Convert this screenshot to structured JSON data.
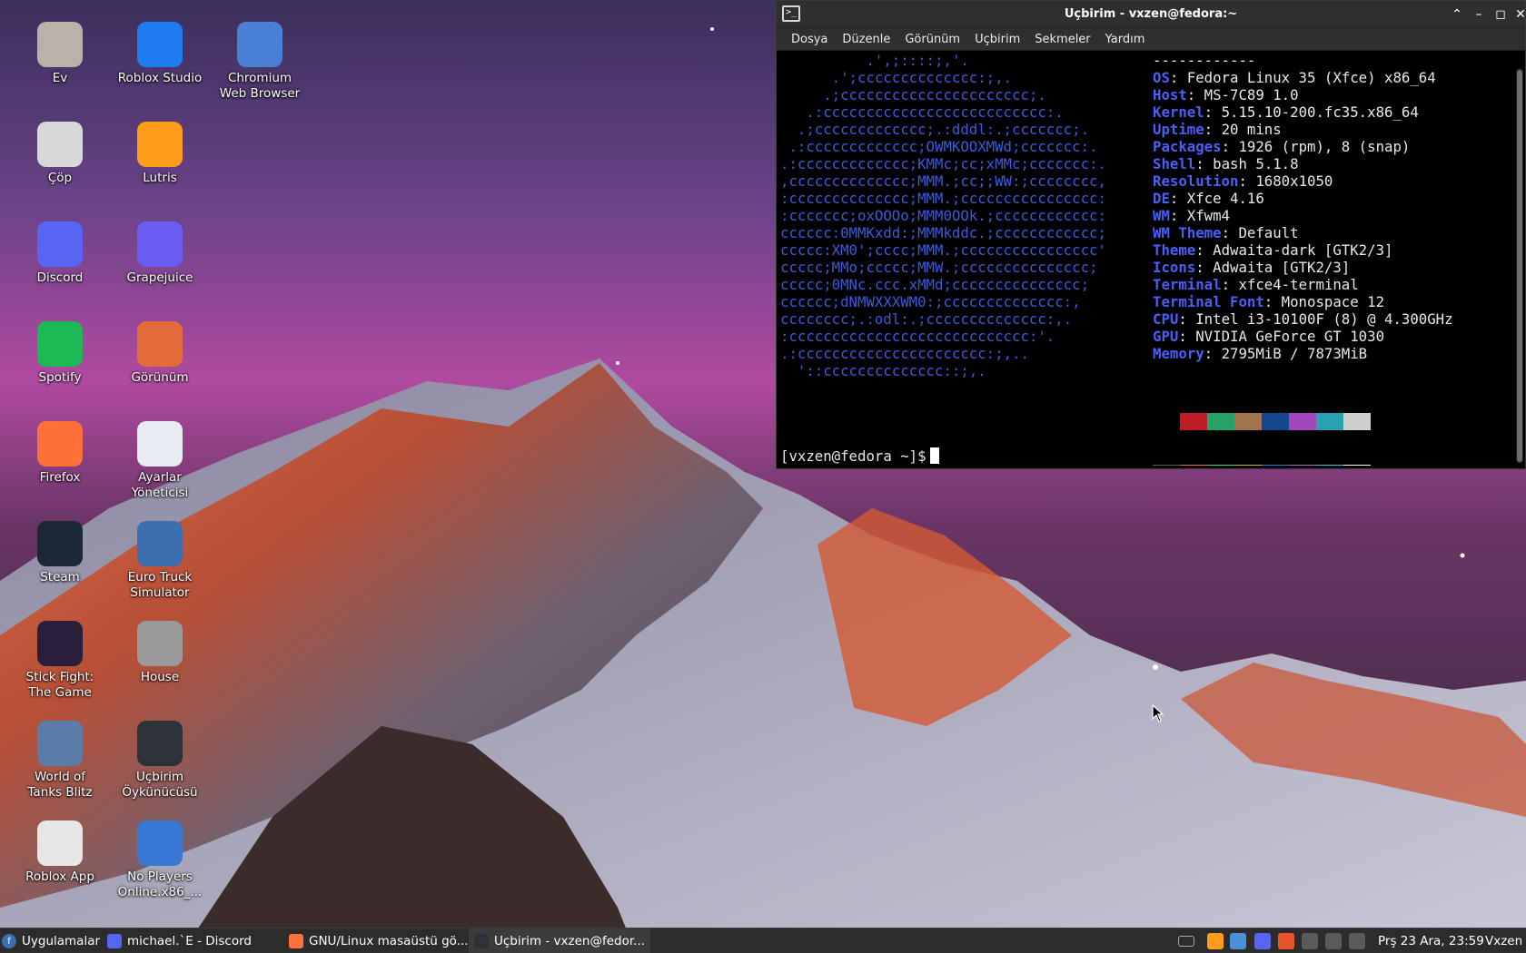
{
  "desktop": {
    "icons": [
      {
        "label": "Ev",
        "icon": "home-folder-icon",
        "color": "#b8b2a8"
      },
      {
        "label": "Roblox Studio",
        "icon": "roblox-studio-icon",
        "color": "#1e7bf2"
      },
      {
        "label": "Chromium\nWeb Browser",
        "icon": "chromium-icon",
        "color": "#4a7fd6"
      },
      {
        "label": "Çöp",
        "icon": "trash-icon",
        "color": "#d8d8d8"
      },
      {
        "label": "Lutris",
        "icon": "lutris-icon",
        "color": "#ff9c1a"
      },
      {
        "label": "Discord",
        "icon": "discord-icon",
        "color": "#5865f2"
      },
      {
        "label": "Grapejuice",
        "icon": "grapejuice-icon",
        "color": "#6a5cf0"
      },
      {
        "label": "Spotify",
        "icon": "spotify-icon",
        "color": "#1db954"
      },
      {
        "label": "Görünüm",
        "icon": "appearance-icon",
        "color": "#e36b3a"
      },
      {
        "label": "Firefox",
        "icon": "firefox-icon",
        "color": "#ff7139"
      },
      {
        "label": "Ayarlar\nYöneticisi",
        "icon": "settings-manager-icon",
        "color": "#e8ecf2"
      },
      {
        "label": "Steam",
        "icon": "steam-icon",
        "color": "#1b2838"
      },
      {
        "label": "Euro Truck\nSimulator",
        "icon": "euro-truck-simulator-icon",
        "color": "#3d6fb0"
      },
      {
        "label": "Stick Fight:\nThe Game",
        "icon": "stick-fight-icon",
        "color": "#2a1f3a"
      },
      {
        "label": "House",
        "icon": "house-icon",
        "color": "#9a9a9a"
      },
      {
        "label": "World of\nTanks Blitz",
        "icon": "world-of-tanks-icon",
        "color": "#5b7ca8"
      },
      {
        "label": "Uçbirim\nÖykünücüsü",
        "icon": "terminal-emulator-icon",
        "color": "#2d3138"
      },
      {
        "label": "Roblox App",
        "icon": "roblox-app-icon",
        "color": "#e6e6e6"
      },
      {
        "label": "No Players\nOnline.x86_...",
        "icon": "no-players-online-icon",
        "color": "#3a78d6"
      }
    ]
  },
  "terminal": {
    "title": "Uçbirim - vxzen@fedora:~",
    "menu": [
      "Dosya",
      "Düzenle",
      "Görünüm",
      "Uçbirim",
      "Sekmeler",
      "Yardım"
    ],
    "logo_lines": [
      "          .',;::::;,'.",
      "      .';cccccccccccccc:;,.",
      "     .;cccccccccccccccccccccc;.",
      "   .:cccccccccccccccccccccccccc:.",
      "  .;ccccccccccccc;.:dddl:.;ccccccc;.",
      " .:ccccccccccccc;OWMKOOXMWd;ccccccc:.",
      ".:ccccccccccccc;KMMc;cc;xMMc;ccccccc:.",
      ",cccccccccccccc;MMM.;cc;;WW:;cccccccc,",
      ":cccccccccccccc;MMM.;cccccccccccccccc:",
      ":ccccccc;oxOOOo;MMM0OOk.;cccccccccccc:",
      "cccccc:0MMKxdd:;MMMkddc.;cccccccccccc;",
      "ccccc:XM0';cccc;MMM.;cccccccccccccccc'",
      "ccccc;MMo;ccccc;MMW.;ccccccccccccccc;",
      "ccccc;0MNc.ccc.xMMd;ccccccccccccccc;",
      "cccccc;dNMWXXXWM0:;cccccccccccccc:,",
      "cccccccc;.:odl:.;cccccccccccccc:,.",
      ":cccccccccccccccccccccccccccc:'.",
      ".:cccccccccccccccccccccc:;,..",
      "  '::cccccccccccccc::;,."
    ],
    "info_separator": "------------",
    "info": [
      {
        "key": "OS",
        "value": "Fedora Linux 35 (Xfce) x86_64"
      },
      {
        "key": "Host",
        "value": "MS-7C89 1.0"
      },
      {
        "key": "Kernel",
        "value": "5.15.10-200.fc35.x86_64"
      },
      {
        "key": "Uptime",
        "value": "20 mins"
      },
      {
        "key": "Packages",
        "value": "1926 (rpm), 8 (snap)"
      },
      {
        "key": "Shell",
        "value": "bash 5.1.8"
      },
      {
        "key": "Resolution",
        "value": "1680x1050"
      },
      {
        "key": "DE",
        "value": "Xfce 4.16"
      },
      {
        "key": "WM",
        "value": "Xfwm4"
      },
      {
        "key": "WM Theme",
        "value": "Default"
      },
      {
        "key": "Theme",
        "value": "Adwaita-dark [GTK2/3]"
      },
      {
        "key": "Icons",
        "value": "Adwaita [GTK2/3]"
      },
      {
        "key": "Terminal",
        "value": "xfce4-terminal"
      },
      {
        "key": "Terminal Font",
        "value": "Monospace 12"
      },
      {
        "key": "CPU",
        "value": "Intel i3-10100F (8) @ 4.300GHz"
      },
      {
        "key": "GPU",
        "value": "NVIDIA GeForce GT 1030"
      },
      {
        "key": "Memory",
        "value": "2795MiB / 7873MiB"
      }
    ],
    "palette_top": [
      "#000000",
      "#c01c28",
      "#26a269",
      "#a2734c",
      "#12488b",
      "#a347ba",
      "#2aa1b3",
      "#d0cfcc"
    ],
    "palette_bottom": [
      "#5e5c64",
      "#f66151",
      "#33da7a",
      "#e9ad0c",
      "#2a7bde",
      "#c061cb",
      "#33c7de",
      "#ffffff"
    ],
    "prompt": "[vxzen@fedora ~]$"
  },
  "taskbar": {
    "apps_menu": "Uygulamalar",
    "tasks": [
      {
        "label": "michael.`E - Discord",
        "icon": "discord-icon",
        "color": "#5865f2"
      },
      {
        "label": "GNU/Linux masaüstü gö...",
        "icon": "firefox-icon",
        "color": "#ff7139"
      },
      {
        "label": "Uçbirim - vxzen@fedor...",
        "icon": "terminal-icon",
        "color": "#2d3138"
      }
    ],
    "tray_icons": [
      {
        "icon": "lutris-tray-icon",
        "color": "#ff9c1a"
      },
      {
        "icon": "network-icon",
        "color": "#4a90d9"
      },
      {
        "icon": "discord-tray-icon",
        "color": "#5865f2"
      },
      {
        "icon": "shield-tray-icon",
        "color": "#e8552b"
      },
      {
        "icon": "volume-icon",
        "color": "#5a5a5a"
      },
      {
        "icon": "power-icon",
        "color": "#5a5a5a"
      },
      {
        "icon": "notifications-icon",
        "color": "#5a5a5a"
      }
    ],
    "clock": "Prş 23 Ara, 23:59",
    "user": "Vxzen"
  }
}
